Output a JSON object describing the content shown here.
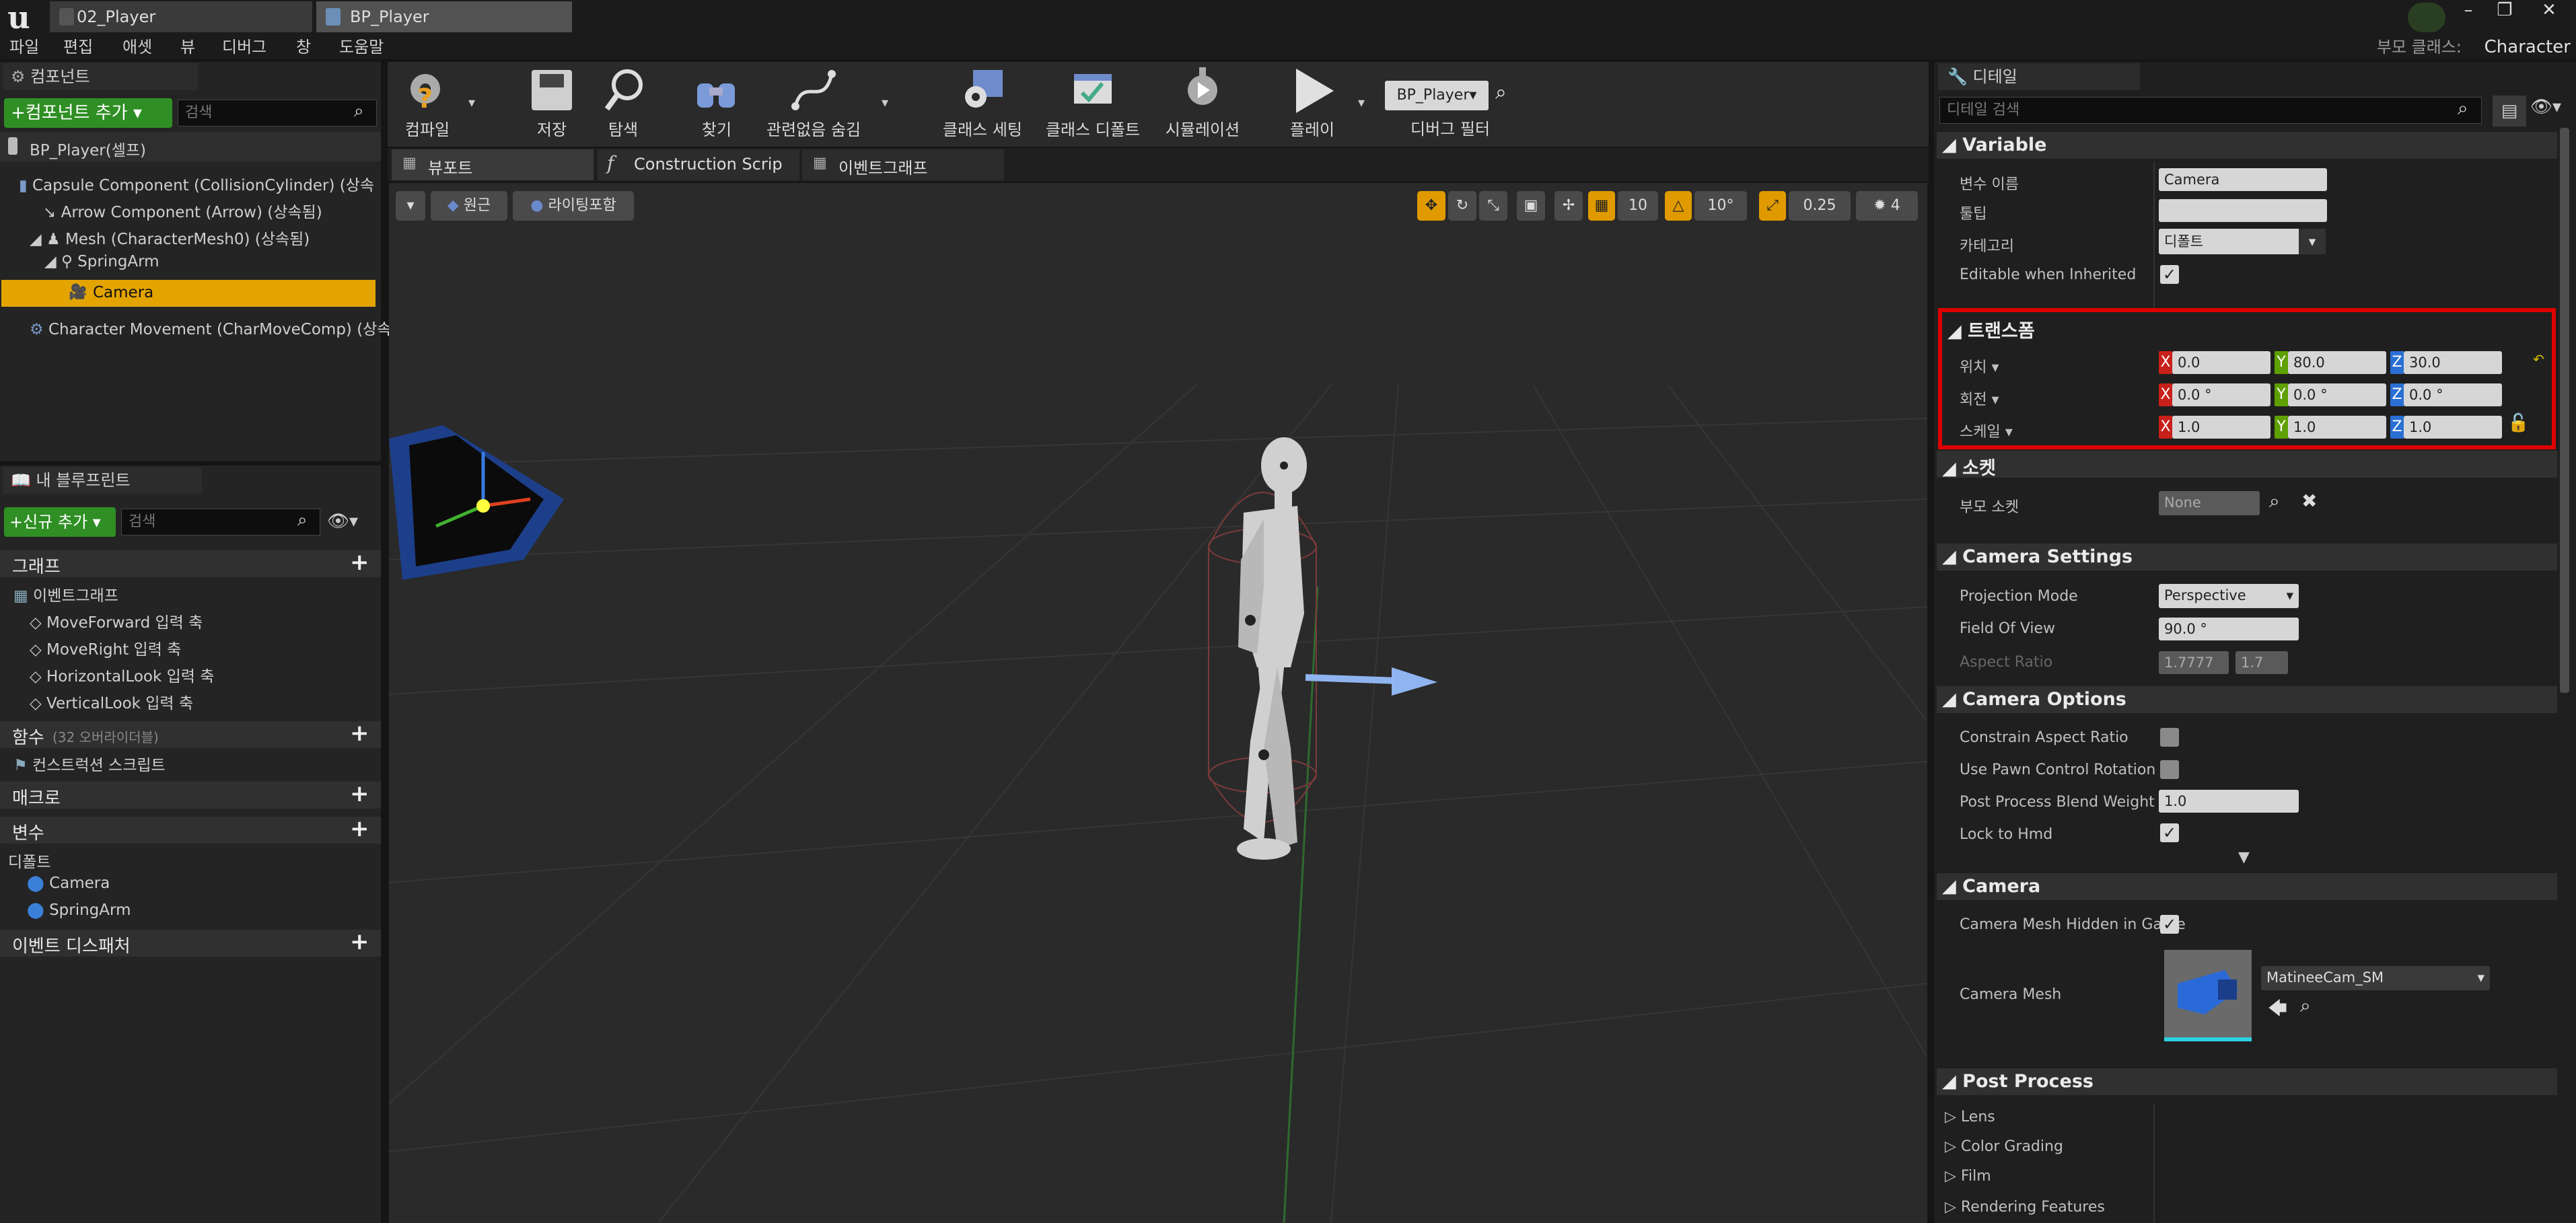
{
  "title_tabs": [
    {
      "label": "02_Player"
    },
    {
      "label": "BP_Player"
    }
  ],
  "parent_class_label": "부모 클래스:",
  "parent_class_value": "Character",
  "menu": [
    "파일",
    "편집",
    "애셋",
    "뷰",
    "디버그",
    "창",
    "도움말"
  ],
  "components": {
    "tab_label": "컴포넌트",
    "add_button": "+컴포넌트 추가 ▾",
    "search_placeholder": "검색",
    "root": "BP_Player(셀프)",
    "items": [
      "Capsule Component (CollisionCylinder) (상속",
      "Arrow Component (Arrow) (상속됨)",
      "Mesh (CharacterMesh0) (상속됨)",
      "SpringArm",
      "Camera",
      "Character Movement (CharMoveComp) (상속"
    ]
  },
  "myblueprint": {
    "tab_label": "내 블루프린트",
    "add_new": "+신규 추가 ▾",
    "search_placeholder": "검색",
    "graphs_label": "그래프",
    "eventgraph_label": "이벤트그래프",
    "events": [
      "MoveForward 입력 축",
      "MoveRight 입력 축",
      "HorizontalLook 입력 축",
      "VerticalLook 입력 축"
    ],
    "functions_label": "함수",
    "functions_note": "(32 오버라이더블)",
    "construction_script": "컨스트럭션 스크립트",
    "macros_label": "매크로",
    "variables_label": "변수",
    "defaults_label": "디폴트",
    "default_items": [
      "Camera",
      "SpringArm"
    ],
    "dispatchers_label": "이벤트 디스패처"
  },
  "toolbar": {
    "compile": "컴파일",
    "save": "저장",
    "browse": "탐색",
    "find": "찾기",
    "hide_unrelated": "관련없음 숨김",
    "class_settings": "클래스 세팅",
    "class_defaults": "클래스 디폴트",
    "simulation": "시뮬레이션",
    "play": "플레이",
    "debug_object": "BP_Player▾",
    "debug_filter": "디버그 필터"
  },
  "editor_tabs": [
    "뷰포트",
    "Construction Scrip",
    "이벤트그래프"
  ],
  "viewport": {
    "perspective": "원근",
    "lighting": "라이팅포함",
    "grid_snap": "10",
    "rot_snap": "10°",
    "scale_snap": "0.25",
    "cam_speed": "4"
  },
  "details": {
    "tab_label": "디테일",
    "search_placeholder": "디테일 검색",
    "variable": {
      "title": "Variable",
      "var_name_label": "변수 이름",
      "var_name_value": "Camera",
      "tooltip_label": "툴팁",
      "tooltip_value": "",
      "category_label": "카테고리",
      "category_value": "디폴트",
      "editable_label": "Editable when Inherited"
    },
    "transform": {
      "title": "트랜스폼",
      "location_label": "위치 ▾",
      "location": [
        "0.0",
        "80.0",
        "30.0"
      ],
      "rotation_label": "회전 ▾",
      "rotation": [
        "0.0 °",
        "0.0 °",
        "0.0 °"
      ],
      "scale_label": "스케일 ▾",
      "scale": [
        "1.0",
        "1.0",
        "1.0"
      ],
      "axes": [
        "X",
        "Y",
        "Z"
      ]
    },
    "sockets": {
      "title": "소켓",
      "parent_socket_label": "부모 소켓",
      "parent_socket_value": "None"
    },
    "camera_settings": {
      "title": "Camera Settings",
      "projection_label": "Projection Mode",
      "projection_value": "Perspective",
      "fov_label": "Field Of View",
      "fov_value": "90.0 °",
      "aspect_label": "Aspect Ratio",
      "aspect_value": "1.7777",
      "aspect_value2": "1.7"
    },
    "camera_options": {
      "title": "Camera Options",
      "constrain_label": "Constrain Aspect Ratio",
      "pawn_rot_label": "Use Pawn Control Rotation",
      "blend_label": "Post Process Blend Weight",
      "blend_value": "1.0",
      "hmd_label": "Lock to Hmd"
    },
    "camera": {
      "title": "Camera",
      "hidden_label": "Camera Mesh Hidden in Game",
      "mesh_label": "Camera Mesh",
      "mesh_value": "MatineeCam_SM"
    },
    "post_process": {
      "title": "Post Process",
      "items": [
        "Lens",
        "Color Grading",
        "Film",
        "Rendering Features"
      ]
    }
  },
  "colors": {
    "accent": "#e0a400",
    "highlight_box": "#e00000",
    "axis_x": "#c8201a",
    "axis_y": "#5ea000",
    "axis_z": "#2a6fd4",
    "green_button": "#2f8f24"
  }
}
